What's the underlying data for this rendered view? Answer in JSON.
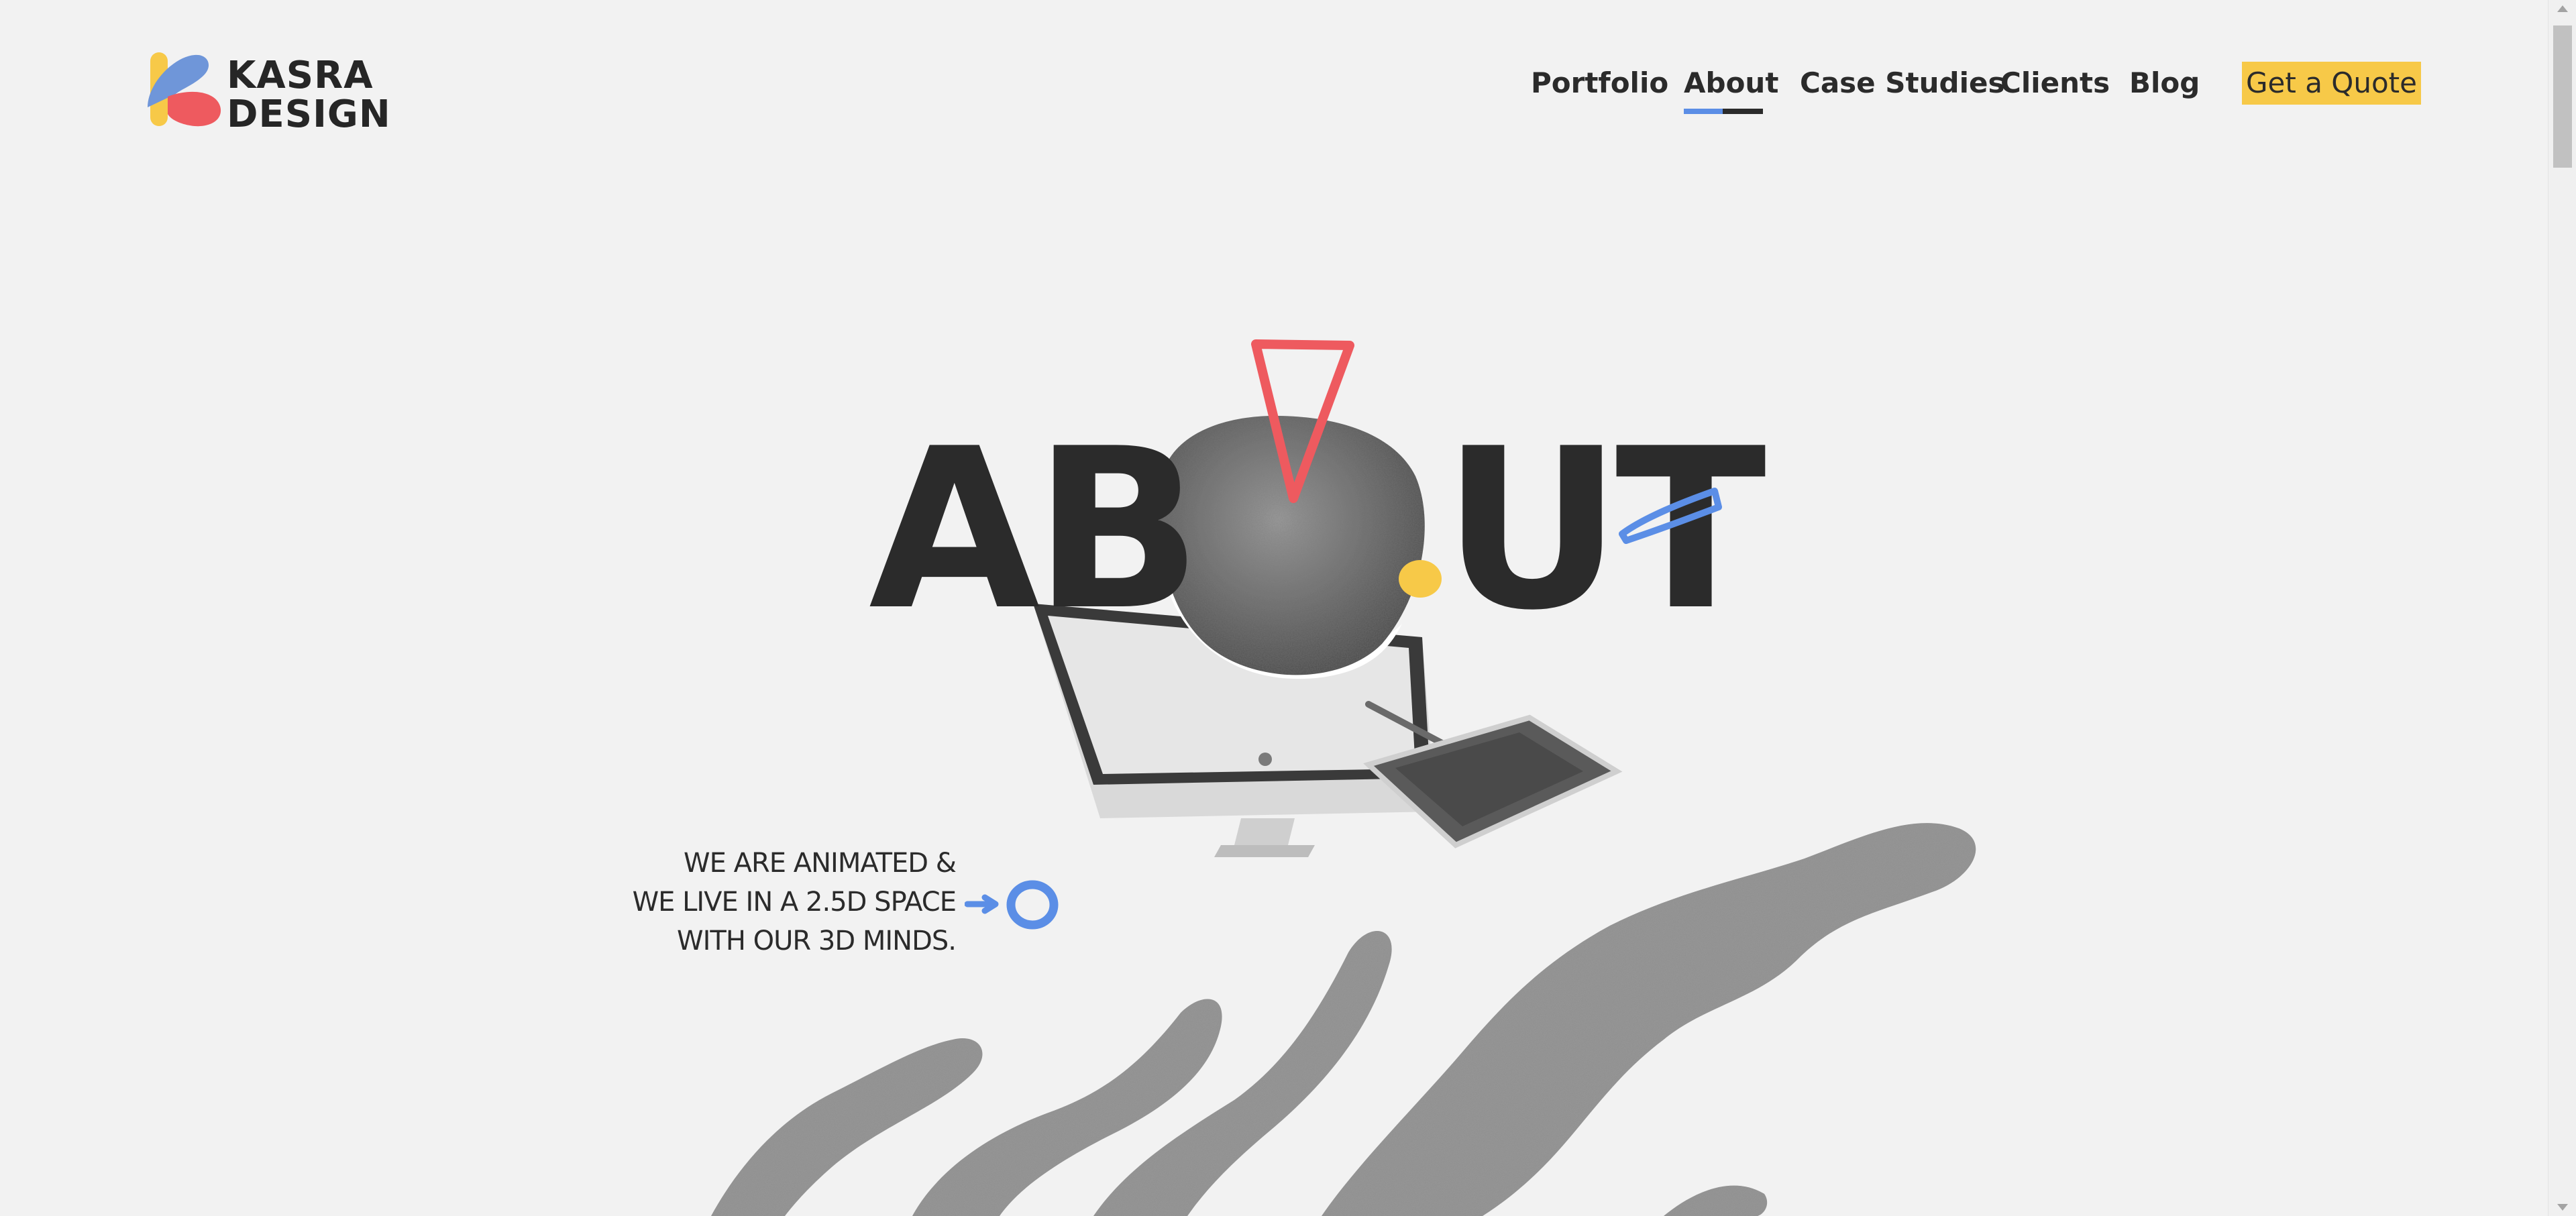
{
  "brand": {
    "name_line1": "KASRA",
    "name_line2": "DESIGN",
    "colors": {
      "yellow": "#f7c948",
      "blue": "#5b8ee6",
      "red": "#ee5a5f",
      "dark": "#2b2b2b"
    }
  },
  "nav": {
    "items": [
      {
        "label": "Portfolio",
        "active": false
      },
      {
        "label": "About",
        "active": true
      },
      {
        "label": "Case Studies",
        "active": false
      },
      {
        "label": "Clients",
        "active": false
      },
      {
        "label": "Blog",
        "active": false
      }
    ],
    "cta": "Get a Quote"
  },
  "hero": {
    "title_part1": "AB",
    "title_part2": "UT",
    "tagline": {
      "line1": "WE ARE ANIMATED &",
      "line2": "WE LIVE IN A 2.5D SPACE",
      "line3": "WITH OUR 3D MINDS."
    }
  },
  "icons": {
    "logo": "kasra-logo-mark",
    "illustration": "imac-and-drawing-tablet",
    "decor": [
      "red-triangle",
      "blue-pencil-stroke",
      "yellow-dot",
      "blue-ring",
      "blue-arrow",
      "textured-brush-waves"
    ]
  }
}
